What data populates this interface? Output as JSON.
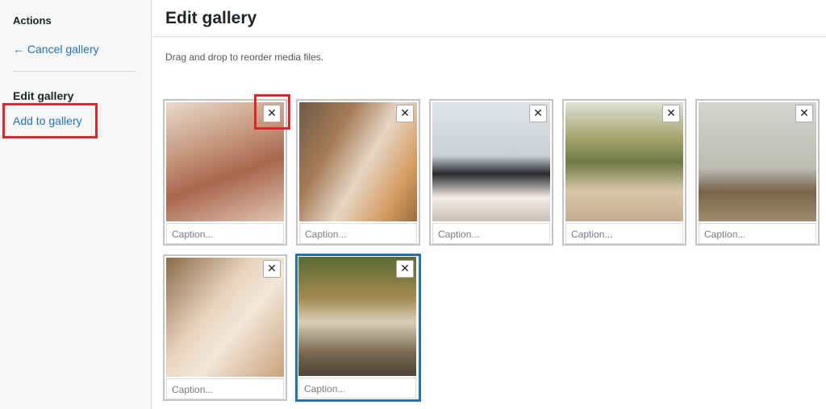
{
  "sidebar": {
    "heading": "Actions",
    "cancel_link": "← Cancel gallery",
    "section_title": "Edit gallery",
    "add_link": "Add to gallery"
  },
  "main": {
    "title": "Edit gallery",
    "instructions": "Drag and drop to reorder media files."
  },
  "gallery": {
    "remove_icon": "close-icon",
    "items": [
      {
        "caption_placeholder": "Caption...",
        "selected": false
      },
      {
        "caption_placeholder": "Caption...",
        "selected": false
      },
      {
        "caption_placeholder": "Caption...",
        "selected": false
      },
      {
        "caption_placeholder": "Caption...",
        "selected": false
      },
      {
        "caption_placeholder": "Caption...",
        "selected": false
      },
      {
        "caption_placeholder": "Caption...",
        "selected": false
      },
      {
        "caption_placeholder": "Caption...",
        "selected": true
      }
    ]
  },
  "colors": {
    "link": "#2271b1",
    "selected_border": "#2271b1",
    "annotation_highlight": "#e2242a"
  }
}
